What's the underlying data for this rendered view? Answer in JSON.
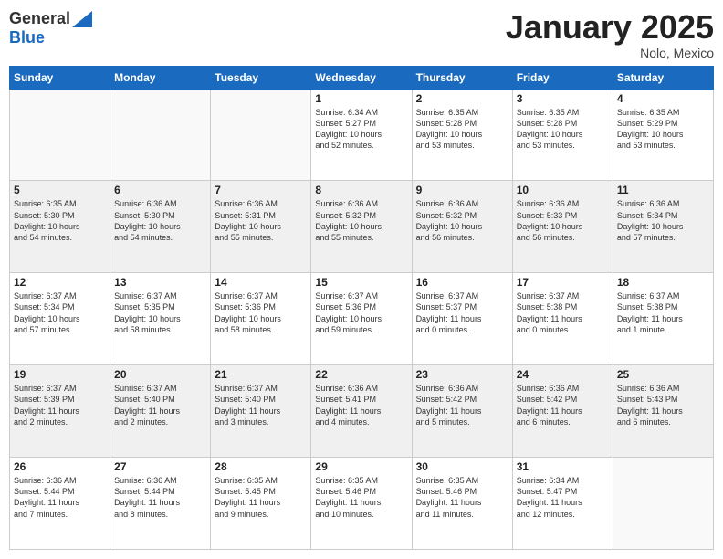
{
  "header": {
    "logo_line1": "General",
    "logo_line2": "Blue",
    "month": "January 2025",
    "location": "Nolo, Mexico"
  },
  "weekdays": [
    "Sunday",
    "Monday",
    "Tuesday",
    "Wednesday",
    "Thursday",
    "Friday",
    "Saturday"
  ],
  "weeks": [
    [
      {
        "day": "",
        "info": ""
      },
      {
        "day": "",
        "info": ""
      },
      {
        "day": "",
        "info": ""
      },
      {
        "day": "1",
        "info": "Sunrise: 6:34 AM\nSunset: 5:27 PM\nDaylight: 10 hours\nand 52 minutes."
      },
      {
        "day": "2",
        "info": "Sunrise: 6:35 AM\nSunset: 5:28 PM\nDaylight: 10 hours\nand 53 minutes."
      },
      {
        "day": "3",
        "info": "Sunrise: 6:35 AM\nSunset: 5:28 PM\nDaylight: 10 hours\nand 53 minutes."
      },
      {
        "day": "4",
        "info": "Sunrise: 6:35 AM\nSunset: 5:29 PM\nDaylight: 10 hours\nand 53 minutes."
      }
    ],
    [
      {
        "day": "5",
        "info": "Sunrise: 6:35 AM\nSunset: 5:30 PM\nDaylight: 10 hours\nand 54 minutes."
      },
      {
        "day": "6",
        "info": "Sunrise: 6:36 AM\nSunset: 5:30 PM\nDaylight: 10 hours\nand 54 minutes."
      },
      {
        "day": "7",
        "info": "Sunrise: 6:36 AM\nSunset: 5:31 PM\nDaylight: 10 hours\nand 55 minutes."
      },
      {
        "day": "8",
        "info": "Sunrise: 6:36 AM\nSunset: 5:32 PM\nDaylight: 10 hours\nand 55 minutes."
      },
      {
        "day": "9",
        "info": "Sunrise: 6:36 AM\nSunset: 5:32 PM\nDaylight: 10 hours\nand 56 minutes."
      },
      {
        "day": "10",
        "info": "Sunrise: 6:36 AM\nSunset: 5:33 PM\nDaylight: 10 hours\nand 56 minutes."
      },
      {
        "day": "11",
        "info": "Sunrise: 6:36 AM\nSunset: 5:34 PM\nDaylight: 10 hours\nand 57 minutes."
      }
    ],
    [
      {
        "day": "12",
        "info": "Sunrise: 6:37 AM\nSunset: 5:34 PM\nDaylight: 10 hours\nand 57 minutes."
      },
      {
        "day": "13",
        "info": "Sunrise: 6:37 AM\nSunset: 5:35 PM\nDaylight: 10 hours\nand 58 minutes."
      },
      {
        "day": "14",
        "info": "Sunrise: 6:37 AM\nSunset: 5:36 PM\nDaylight: 10 hours\nand 58 minutes."
      },
      {
        "day": "15",
        "info": "Sunrise: 6:37 AM\nSunset: 5:36 PM\nDaylight: 10 hours\nand 59 minutes."
      },
      {
        "day": "16",
        "info": "Sunrise: 6:37 AM\nSunset: 5:37 PM\nDaylight: 11 hours\nand 0 minutes."
      },
      {
        "day": "17",
        "info": "Sunrise: 6:37 AM\nSunset: 5:38 PM\nDaylight: 11 hours\nand 0 minutes."
      },
      {
        "day": "18",
        "info": "Sunrise: 6:37 AM\nSunset: 5:38 PM\nDaylight: 11 hours\nand 1 minute."
      }
    ],
    [
      {
        "day": "19",
        "info": "Sunrise: 6:37 AM\nSunset: 5:39 PM\nDaylight: 11 hours\nand 2 minutes."
      },
      {
        "day": "20",
        "info": "Sunrise: 6:37 AM\nSunset: 5:40 PM\nDaylight: 11 hours\nand 2 minutes."
      },
      {
        "day": "21",
        "info": "Sunrise: 6:37 AM\nSunset: 5:40 PM\nDaylight: 11 hours\nand 3 minutes."
      },
      {
        "day": "22",
        "info": "Sunrise: 6:36 AM\nSunset: 5:41 PM\nDaylight: 11 hours\nand 4 minutes."
      },
      {
        "day": "23",
        "info": "Sunrise: 6:36 AM\nSunset: 5:42 PM\nDaylight: 11 hours\nand 5 minutes."
      },
      {
        "day": "24",
        "info": "Sunrise: 6:36 AM\nSunset: 5:42 PM\nDaylight: 11 hours\nand 6 minutes."
      },
      {
        "day": "25",
        "info": "Sunrise: 6:36 AM\nSunset: 5:43 PM\nDaylight: 11 hours\nand 6 minutes."
      }
    ],
    [
      {
        "day": "26",
        "info": "Sunrise: 6:36 AM\nSunset: 5:44 PM\nDaylight: 11 hours\nand 7 minutes."
      },
      {
        "day": "27",
        "info": "Sunrise: 6:36 AM\nSunset: 5:44 PM\nDaylight: 11 hours\nand 8 minutes."
      },
      {
        "day": "28",
        "info": "Sunrise: 6:35 AM\nSunset: 5:45 PM\nDaylight: 11 hours\nand 9 minutes."
      },
      {
        "day": "29",
        "info": "Sunrise: 6:35 AM\nSunset: 5:46 PM\nDaylight: 11 hours\nand 10 minutes."
      },
      {
        "day": "30",
        "info": "Sunrise: 6:35 AM\nSunset: 5:46 PM\nDaylight: 11 hours\nand 11 minutes."
      },
      {
        "day": "31",
        "info": "Sunrise: 6:34 AM\nSunset: 5:47 PM\nDaylight: 11 hours\nand 12 minutes."
      },
      {
        "day": "",
        "info": ""
      }
    ]
  ]
}
